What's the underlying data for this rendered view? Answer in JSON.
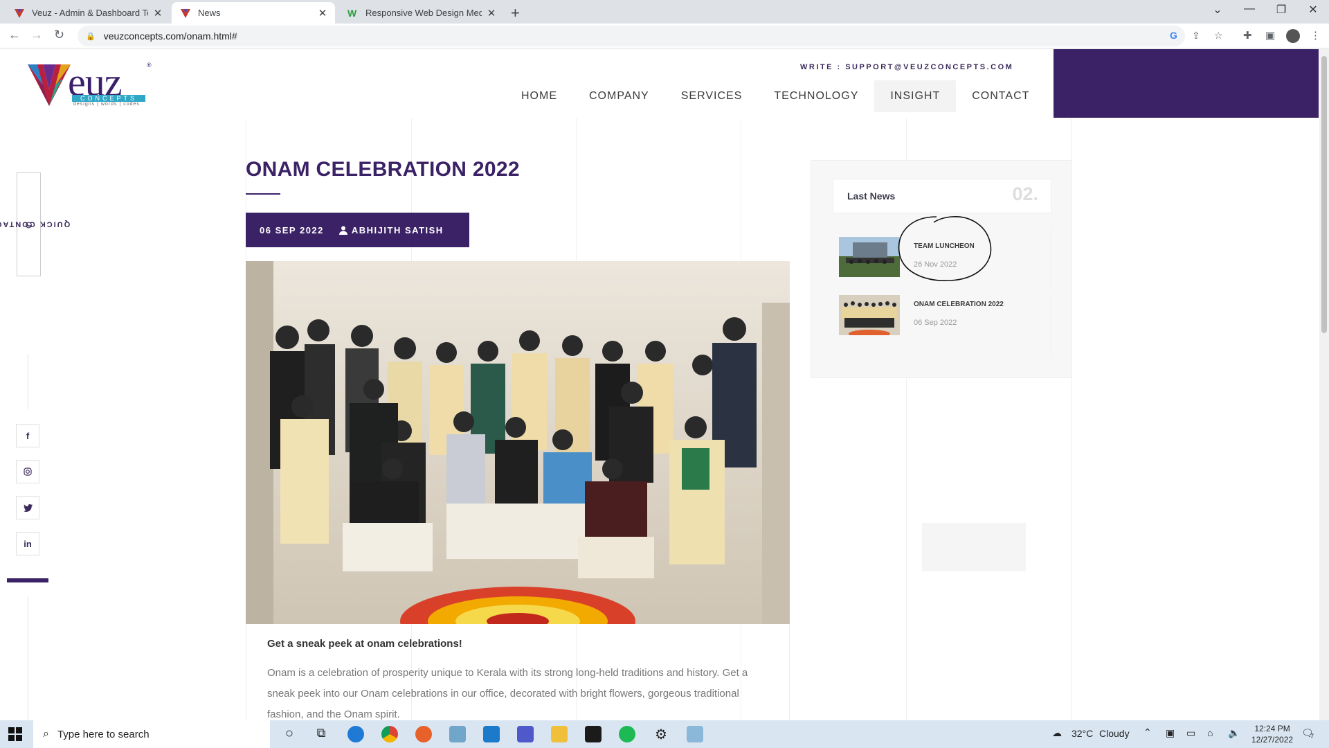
{
  "browser": {
    "tabs": [
      {
        "title": "Veuz - Admin & Dashboard Temp",
        "active": false
      },
      {
        "title": "News",
        "active": true
      },
      {
        "title": "Responsive Web Design Media Q",
        "active": false
      }
    ],
    "url": "veuzconcepts.com/onam.html#"
  },
  "site": {
    "logo_text": "euz",
    "logo_bar": "CONCEPTS",
    "logo_sub": "designs | words | codes",
    "logo_reg": "®",
    "write_line": "WRITE : SUPPORT@VEUZCONCEPTS.COM",
    "nav": [
      {
        "label": "HOME",
        "active": false
      },
      {
        "label": "COMPANY",
        "active": false
      },
      {
        "label": "SERVICES",
        "active": false
      },
      {
        "label": "TECHNOLOGY",
        "active": false
      },
      {
        "label": "INSIGHT",
        "active": true
      },
      {
        "label": "CONTACT",
        "active": false
      }
    ],
    "quick_contact": "QUICK CONTACT",
    "social": [
      {
        "icon": "facebook-icon",
        "glyph": "f"
      },
      {
        "icon": "instagram-icon",
        "glyph": "◎"
      },
      {
        "icon": "twitter-icon",
        "glyph": "🐦"
      },
      {
        "icon": "linkedin-icon",
        "glyph": "in"
      }
    ],
    "brand_color": "#3b2266"
  },
  "post": {
    "title": "ONAM CELEBRATION 2022",
    "date": "06 SEP 2022",
    "author": "ABHIJITH SATISH",
    "lead": "Get a sneak peek at onam celebrations!",
    "body": "Onam is a celebration of prosperity unique to Kerala with its strong long-held traditions and history. Get a sneak peek into our Onam celebrations in our office, decorated with bright flowers, gorgeous traditional fashion, and the Onam spirit."
  },
  "sidebar": {
    "heading": "Last News",
    "count": "02.",
    "items": [
      {
        "title": "TEAM LUNCHEON",
        "date": "26 Nov 2022"
      },
      {
        "title": "ONAM CELEBRATION 2022",
        "date": "06 Sep 2022"
      }
    ]
  },
  "taskbar": {
    "search_placeholder": "Type here to search",
    "weather_temp": "32°C",
    "weather_text": "Cloudy",
    "time": "12:24 PM",
    "date": "12/27/2022",
    "notification_count": "7"
  }
}
